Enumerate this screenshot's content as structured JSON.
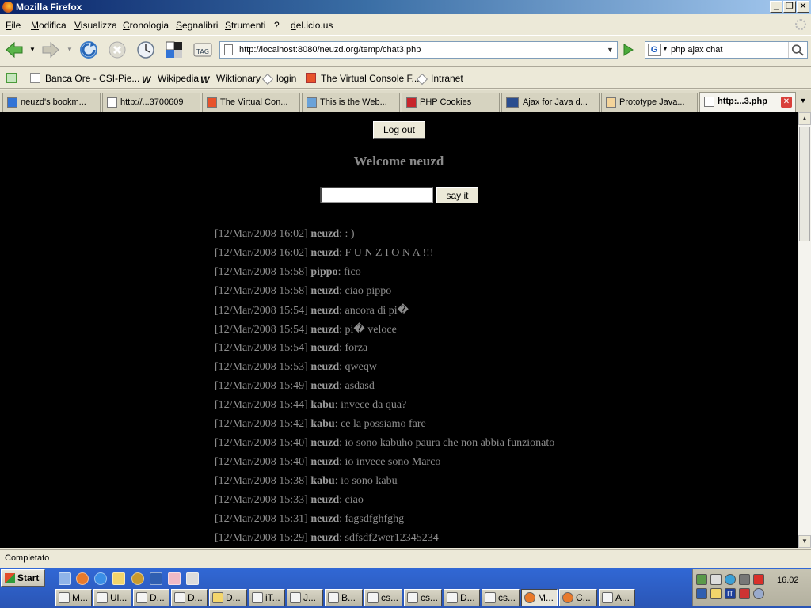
{
  "window": {
    "title": "Mozilla Firefox"
  },
  "menu": [
    "File",
    "Modifica",
    "Visualizza",
    "Cronologia",
    "Segnalibri",
    "Strumenti",
    "?",
    "del.icio.us"
  ],
  "nav": {
    "url": "http://localhost:8080/neuzd.org/temp/chat3.php",
    "search_value": "php ajax chat",
    "search_engine": "G"
  },
  "bookmarks": [
    "Banca Ore - CSI-Pie...",
    "Wikipedia",
    "Wiktionary",
    "login",
    "The Virtual Console F...",
    "Intranet"
  ],
  "tabs": [
    "neuzd's bookm...",
    "http://...3700609",
    "The Virtual Con...",
    "This is the Web...",
    "PHP Cookies",
    "Ajax for Java d...",
    "Prototype Java...",
    "http:...3.php"
  ],
  "page": {
    "logout_label": "Log out",
    "welcome": "Welcome neuzd",
    "input_value": "",
    "sayit_label": "say it",
    "messages": [
      {
        "time": "[12/Mar/2008 16:02]",
        "user": "neuzd",
        "text": ": : )"
      },
      {
        "time": "[12/Mar/2008 16:02]",
        "user": "neuzd",
        "text": ": F U N Z I O N A !!!"
      },
      {
        "time": "[12/Mar/2008 15:58]",
        "user": "pippo",
        "text": ": fico"
      },
      {
        "time": "[12/Mar/2008 15:58]",
        "user": "neuzd",
        "text": ": ciao pippo"
      },
      {
        "time": "[12/Mar/2008 15:54]",
        "user": "neuzd",
        "text": ": ancora di pi�"
      },
      {
        "time": "[12/Mar/2008 15:54]",
        "user": "neuzd",
        "text": ": pi� veloce"
      },
      {
        "time": "[12/Mar/2008 15:54]",
        "user": "neuzd",
        "text": ": forza"
      },
      {
        "time": "[12/Mar/2008 15:53]",
        "user": "neuzd",
        "text": ": qweqw"
      },
      {
        "time": "[12/Mar/2008 15:49]",
        "user": "neuzd",
        "text": ": asdasd"
      },
      {
        "time": "[12/Mar/2008 15:44]",
        "user": "kabu",
        "text": ":  invece da qua?"
      },
      {
        "time": "[12/Mar/2008 15:42]",
        "user": "kabu",
        "text": ":  ce la possiamo fare"
      },
      {
        "time": "[12/Mar/2008 15:40]",
        "user": "neuzd",
        "text": ": io sono kabuho paura che non abbia funzionato"
      },
      {
        "time": "[12/Mar/2008 15:40]",
        "user": "neuzd",
        "text": ": io invece sono Marco"
      },
      {
        "time": "[12/Mar/2008 15:38]",
        "user": "kabu",
        "text": ":  io sono kabu"
      },
      {
        "time": "[12/Mar/2008 15:33]",
        "user": "neuzd",
        "text": ": ciao"
      },
      {
        "time": "[12/Mar/2008 15:31]",
        "user": "neuzd",
        "text": ": fagsdfghfghg"
      },
      {
        "time": "[12/Mar/2008 15:29]",
        "user": "neuzd",
        "text": ": sdfsdf2wer12345234"
      }
    ]
  },
  "status": "Completato",
  "taskbar": {
    "start_label": "Start",
    "tasks": [
      "M...",
      "Ul...",
      "D...",
      "D...",
      "D...",
      "iT...",
      "J...",
      "B...",
      "cs...",
      "cs...",
      "D...",
      "cs...",
      "M...",
      "C...",
      "A..."
    ],
    "clock": "16.02"
  },
  "colors": {
    "page_bg": "#000000",
    "chat_text": "#8e8e8e",
    "titlebar": "#0a246a"
  }
}
